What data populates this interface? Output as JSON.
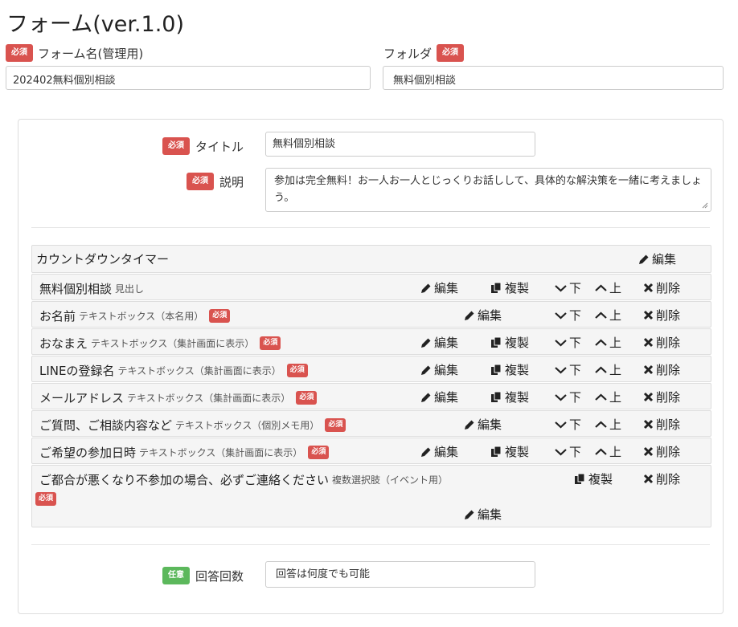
{
  "page": {
    "title": "フォーム(ver.1.0)"
  },
  "badges": {
    "required": "必須",
    "optional": "任意"
  },
  "top": {
    "form_name_label": "フォーム名(管理用)",
    "form_name_value": "202402無料個別相談",
    "folder_label": "フォルダ",
    "folder_value": "無料個別相談"
  },
  "form": {
    "title_label": "タイトル",
    "title_value": "無料個別相談",
    "description_label": "説明",
    "description_value": "参加は完全無料！お一人お一人とじっくりお話しして、具体的な解決策を一緒に考えましょう。",
    "answer_count_label": "回答回数",
    "answer_count_value": "回答は何度でも可能"
  },
  "actions": {
    "edit": "編集",
    "copy": "複製",
    "down": "下",
    "up": "上",
    "delete": "削除"
  },
  "items": [
    {
      "name": "カウントダウンタイマー",
      "type": "",
      "required": false
    },
    {
      "name": "無料個別相談",
      "type": "見出し",
      "required": false
    },
    {
      "name": "お名前",
      "type": "テキストボックス（本名用）",
      "required": true
    },
    {
      "name": "おなまえ",
      "type": "テキストボックス（集計画面に表示）",
      "required": true
    },
    {
      "name": "LINEの登録名",
      "type": "テキストボックス（集計画面に表示）",
      "required": true
    },
    {
      "name": "メールアドレス",
      "type": "テキストボックス（集計画面に表示）",
      "required": true
    },
    {
      "name": "ご質問、ご相談内容など",
      "type": "テキストボックス（個別メモ用）",
      "required": true
    },
    {
      "name": "ご希望の参加日時",
      "type": "テキストボックス（集計画面に表示）",
      "required": true
    },
    {
      "name": "ご都合が悪くなり不参加の場合、必ずご連絡ください",
      "type": "複数選択肢（イベント用）",
      "required": true
    }
  ]
}
